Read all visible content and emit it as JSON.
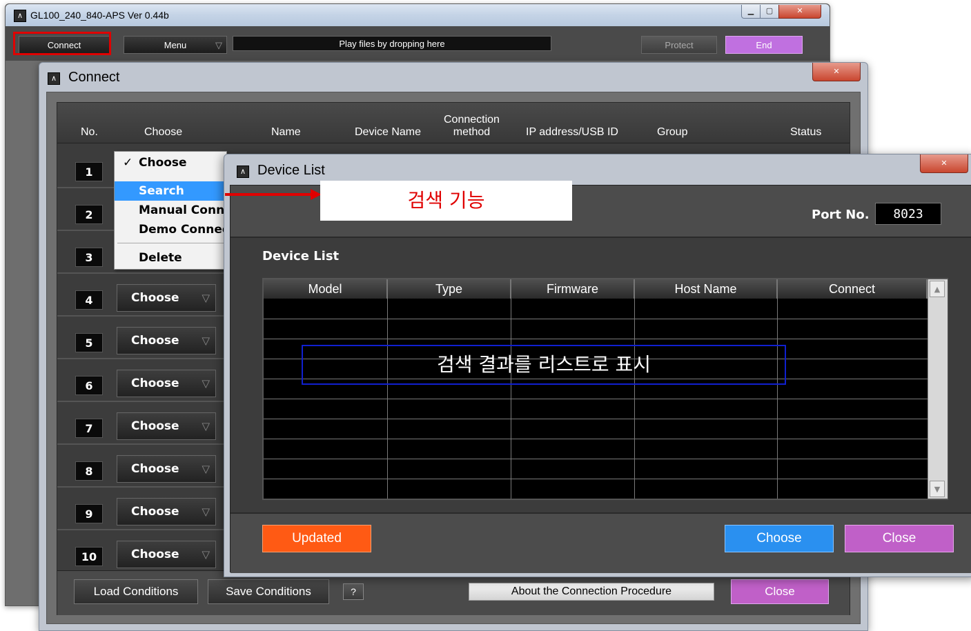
{
  "main_window": {
    "title": "GL100_240_840-APS Ver 0.44b",
    "toolbar": {
      "connect_label": "Connect",
      "menu_label": "Menu",
      "drop_zone": "Play files by dropping here",
      "protect_label": "Protect",
      "end_label": "End"
    }
  },
  "connect_dialog": {
    "title": "Connect",
    "headers": {
      "no": "No.",
      "choose": "Choose",
      "name": "Name",
      "device_name": "Device Name",
      "connection_method_1": "Connection",
      "connection_method_2": "method",
      "ip": "IP address/USB ID",
      "group": "Group",
      "status": "Status"
    },
    "rows": [
      {
        "no": "1"
      },
      {
        "no": "2"
      },
      {
        "no": "3"
      },
      {
        "no": "4",
        "choose": "Choose"
      },
      {
        "no": "5",
        "choose": "Choose"
      },
      {
        "no": "6",
        "choose": "Choose"
      },
      {
        "no": "7",
        "choose": "Choose"
      },
      {
        "no": "8",
        "choose": "Choose"
      },
      {
        "no": "9",
        "choose": "Choose"
      },
      {
        "no": "10",
        "choose": "Choose"
      }
    ],
    "dropdown": {
      "items": [
        "Choose",
        "Search",
        "Manual Conne",
        "Demo Connec",
        "Delete"
      ],
      "checked": "Choose",
      "highlighted": "Search"
    },
    "footer": {
      "load": "Load Conditions",
      "save": "Save Conditions",
      "help": "?",
      "about": "About the Connection Procedure",
      "close": "Close"
    }
  },
  "device_list": {
    "title": "Device List",
    "port_label": "Port No.",
    "port_value": "8023",
    "section_title": "Device List",
    "columns": [
      "Model",
      "Type",
      "Firmware",
      "Host Name",
      "Connect"
    ],
    "buttons": {
      "updated": "Updated",
      "choose": "Choose",
      "close": "Close"
    }
  },
  "annotations": {
    "search_note": "검색 기능",
    "results_note": "검색 결과를 리스트로 표시"
  },
  "colors": {
    "highlight": "#3399ff",
    "end_button": "#c070e0",
    "updated_button": "#ff5a14",
    "choose_button": "#2a90f0",
    "close_button": "#c060c8",
    "annotation_red": "#e00000",
    "annotation_blue": "#1020d0"
  }
}
